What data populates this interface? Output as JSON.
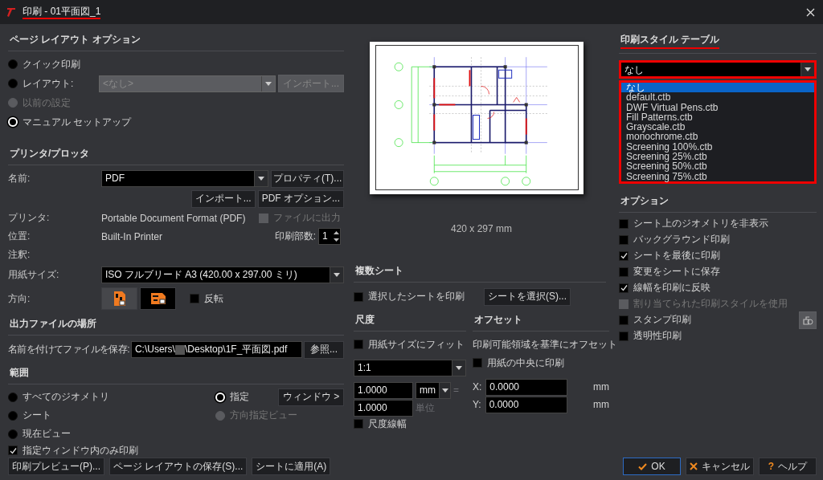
{
  "window": {
    "title": "印刷 - 01平面図_1"
  },
  "page_layout": {
    "heading": "ページ レイアウト オプション",
    "options": [
      {
        "label": "クイック印刷",
        "selected": false,
        "disabled": false
      },
      {
        "label": "レイアウト:",
        "selected": false,
        "disabled": false
      },
      {
        "label": "以前の設定",
        "selected": false,
        "disabled": true
      },
      {
        "label": "マニュアル セットアップ",
        "selected": true,
        "disabled": false
      }
    ],
    "layout_select": {
      "value": "<なし>",
      "disabled": true
    },
    "import_button": {
      "label": "インポート...",
      "disabled": true
    }
  },
  "printer": {
    "heading": "プリンタ/プロッタ",
    "name_label": "名前:",
    "name_value": "PDF",
    "properties_button": "プロパティ(T)...",
    "import_button": "インポート...",
    "pdf_options_button": "PDF オプション...",
    "printer_label": "プリンタ:",
    "printer_value": "Portable Document Format (PDF)",
    "print_to_file": {
      "label": "ファイルに出力",
      "checked": false,
      "disabled": true
    },
    "location_label": "位置:",
    "location_value": "Built-In Printer",
    "copies_label": "印刷部数:",
    "copies_value": "1",
    "notes_label": "注釈:",
    "paper_label": "用紙サイズ:",
    "paper_value": "ISO フルブリード A3 (420.00 x 297.00 ミリ)",
    "orientation_label": "方向:",
    "orientations": [
      {
        "kind": "portrait",
        "selected": false
      },
      {
        "kind": "landscape",
        "selected": true
      }
    ],
    "reverse": {
      "label": "反転",
      "checked": false
    }
  },
  "output": {
    "heading": "出力ファイルの場所",
    "save_label": "名前を付けてファイルを保存:",
    "path_start": "C:\\Users\\",
    "redacted": true,
    "path_end": "\\Desktop\\1F_平面図.pdf",
    "browse_button": "参照..."
  },
  "range": {
    "heading": "範囲",
    "options": [
      {
        "label": "すべてのジオメトリ",
        "selected": false,
        "disabled": false
      },
      {
        "label": "シート",
        "selected": false,
        "disabled": false
      },
      {
        "label": "現在ビュー",
        "selected": false,
        "disabled": false
      },
      {
        "label": "指定",
        "selected": true,
        "disabled": false
      },
      {
        "label": "方向指定ビュー",
        "selected": false,
        "disabled": true
      }
    ],
    "window_button": "ウィンドウ >",
    "window_only": {
      "label": "指定ウィンドウ内のみ印刷",
      "checked": true
    }
  },
  "buttons": [
    "印刷プレビュー(P)...",
    "ページ レイアウトの保存(S)...",
    "シートに適用(A)"
  ],
  "preview": {
    "paper_size": "420 x 297 mm"
  },
  "multi_sheet": {
    "heading": "複数シート",
    "print_selected": {
      "label": "選択したシートを印刷",
      "checked": false
    },
    "select_button": "シートを選択(S)..."
  },
  "scale": {
    "heading": "尺度",
    "fit": {
      "label": "用紙サイズにフィット",
      "checked": false
    },
    "ratio": "1:1",
    "value1": "1.0000",
    "unit": "mm",
    "equals": "=",
    "value2": "1.0000",
    "unit_label": "単位",
    "lineweights": {
      "label": "尺度線幅",
      "checked": false
    }
  },
  "offset": {
    "heading": "オフセット",
    "basis": "印刷可能領域を基準にオフセット",
    "center": {
      "label": "用紙の中央に印刷",
      "checked": false
    },
    "x_label": "X:",
    "x_value": "0.0000",
    "x_unit": "mm",
    "y_label": "Y:",
    "y_value": "0.0000",
    "y_unit": "mm"
  },
  "style_table": {
    "heading": "印刷スタイル テーブル",
    "value": "なし",
    "items": [
      {
        "label": "なし",
        "selected": true
      },
      {
        "label": "default.ctb",
        "selected": false
      },
      {
        "label": "DWF Virtual Pens.ctb",
        "selected": false
      },
      {
        "label": "Fill Patterns.ctb",
        "selected": false
      },
      {
        "label": "Grayscale.ctb",
        "selected": false
      },
      {
        "label": "monochrome.ctb",
        "selected": false
      },
      {
        "label": "Screening 100%.ctb",
        "selected": false
      },
      {
        "label": "Screening 25%.ctb",
        "selected": false
      },
      {
        "label": "Screening 50%.ctb",
        "selected": false
      },
      {
        "label": "Screening 75%.ctb",
        "selected": false
      }
    ]
  },
  "options": {
    "heading": "オプション",
    "items": [
      {
        "label": "シート上のジオメトリを非表示",
        "checked": false,
        "disabled": false
      },
      {
        "label": "バックグラウンド印刷",
        "checked": false,
        "disabled": false
      },
      {
        "label": "シートを最後に印刷",
        "checked": true,
        "disabled": false
      },
      {
        "label": "変更をシートに保存",
        "checked": false,
        "disabled": false
      },
      {
        "label": "線幅を印刷に反映",
        "checked": true,
        "disabled": false
      },
      {
        "label": "割り当てられた印刷スタイルを使用",
        "checked": false,
        "disabled": true
      },
      {
        "label": "スタンプ印刷",
        "checked": false,
        "disabled": false
      },
      {
        "label": "透明性印刷",
        "checked": false,
        "disabled": false
      }
    ],
    "stamp_button": {
      "disabled": true
    }
  },
  "dialog_buttons": [
    {
      "kind": "ok",
      "label": "OK"
    },
    {
      "kind": "cancel",
      "label": "キャンセル"
    },
    {
      "kind": "help",
      "label": "ヘルプ",
      "icon": "?"
    }
  ]
}
